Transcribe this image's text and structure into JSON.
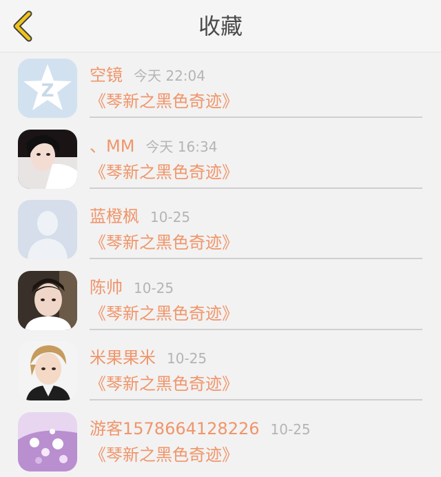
{
  "header": {
    "title": "收藏",
    "accent_color": "#f0c419"
  },
  "favorites": [
    {
      "name": "空镜",
      "time": "今天 22:04",
      "title": "《琴新之黑色奇迹》",
      "avatar": "qzone-star-icon"
    },
    {
      "name": "、MM",
      "time": "今天 16:34",
      "title": "《琴新之黑色奇迹》",
      "avatar": "user-photo-girl"
    },
    {
      "name": "蓝橙枫",
      "time": "10-25",
      "title": "《琴新之黑色奇迹》",
      "avatar": "default-person-icon"
    },
    {
      "name": "陈帅",
      "time": "10-25",
      "title": "《琴新之黑色奇迹》",
      "avatar": "user-photo-boy"
    },
    {
      "name": "米果果米",
      "time": "10-25",
      "title": "《琴新之黑色奇迹》",
      "avatar": "user-photo-man"
    },
    {
      "name": "游客1578664128226",
      "time": "10-25",
      "title": "《琴新之黑色奇迹》",
      "avatar": "user-photo-flowers"
    }
  ],
  "colors": {
    "name_text": "#f0956a",
    "time_text": "#b4b4b4",
    "background": "#f2f2f2"
  }
}
